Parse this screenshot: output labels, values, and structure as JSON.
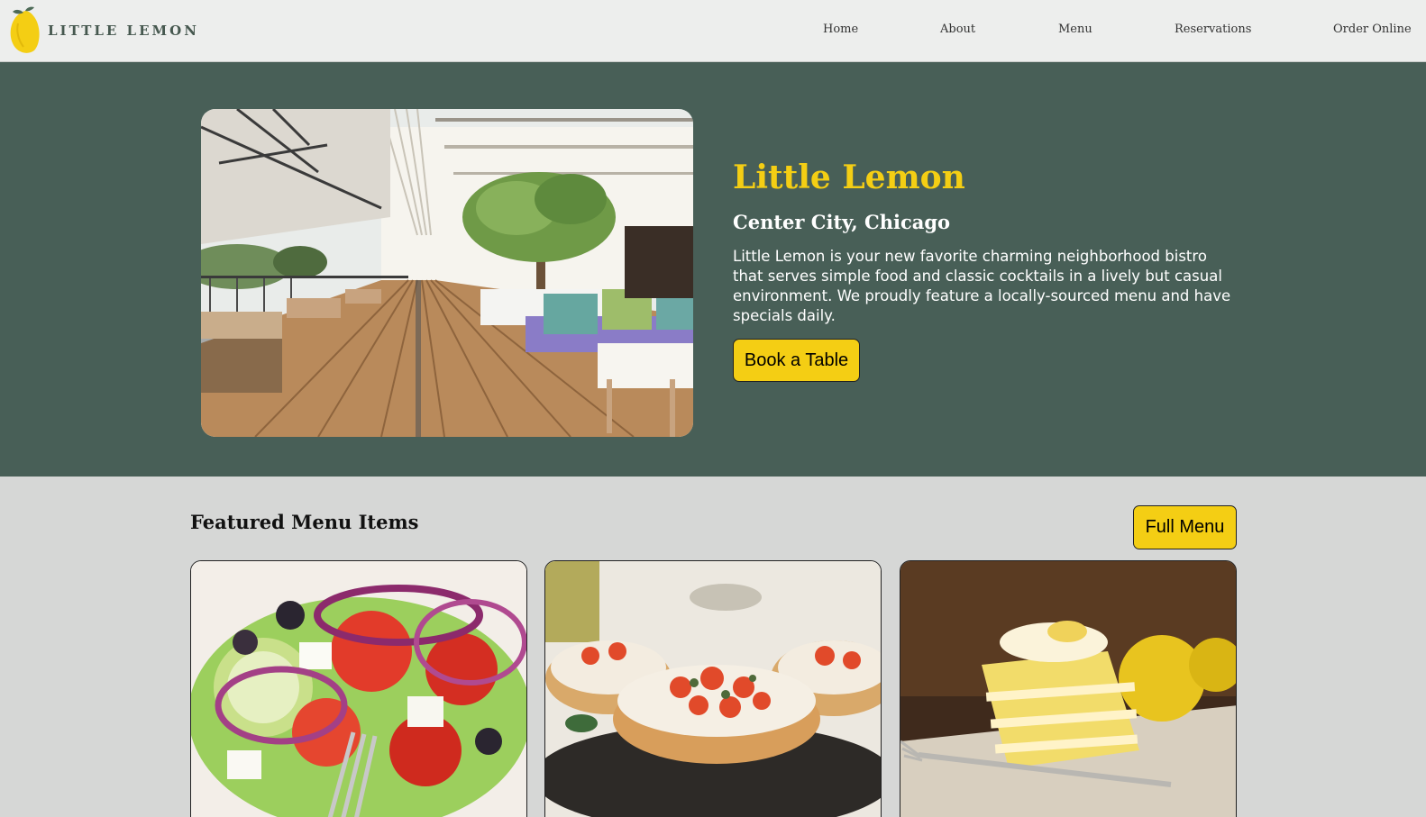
{
  "nav": {
    "brand": "LITTLE LEMON",
    "logo_icon": "lemon-icon",
    "links": [
      "Home",
      "About",
      "Menu",
      "Reservations",
      "Order Online"
    ]
  },
  "hero": {
    "title": "Little Lemon",
    "subtitle": "Center City, Chicago",
    "description": "Little Lemon is your new favorite charming neighborhood bistro that serves simple food and classic cocktails in a lively but casual environment. We proudly feature a locally-sourced menu and have specials daily.",
    "cta_label": "Book a Table"
  },
  "featured": {
    "title": "Featured Menu Items",
    "button_label": "Full Menu"
  },
  "colors": {
    "primary_green": "#485f57",
    "accent_yellow": "#f4ce14",
    "page_bg": "#d6d7d6",
    "nav_bg": "#edeeed"
  }
}
